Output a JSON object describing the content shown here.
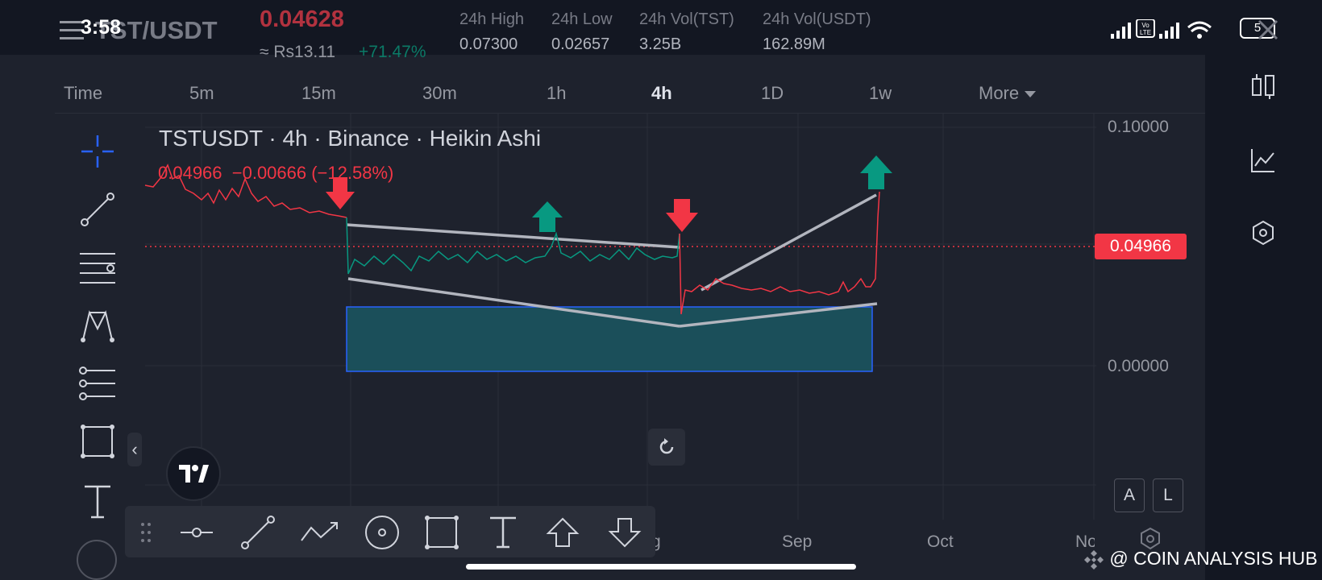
{
  "status_bar": {
    "time": "3:58",
    "battery": "5",
    "lte_label": "Vo LTE"
  },
  "ticker": {
    "symbol": "TST/USDT",
    "price": "0.04628",
    "fiat_price": "≈ Rs13.11",
    "change_pct": "+71.47%",
    "stats": [
      {
        "label": "24h High",
        "value": "0.07300"
      },
      {
        "label": "24h Low",
        "value": "0.02657"
      },
      {
        "label": "24h Vol(TST)",
        "value": "3.25B"
      },
      {
        "label": "24h Vol(USDT)",
        "value": "162.89M"
      }
    ]
  },
  "timeframes": [
    "Time",
    "5m",
    "15m",
    "30m",
    "1h",
    "4h",
    "1D",
    "1w"
  ],
  "active_timeframe": "4h",
  "more_label": "More",
  "chart": {
    "legend_title": "TSTUSDT · 4h · Binance · Heikin Ashi",
    "legend_values": "0.04966  −0.00666 (−12.58%)",
    "current_price_badge": "0.04966",
    "y_ticks": [
      "0.10000",
      "0.00000"
    ],
    "x_ticks": [
      "Aug",
      "Sep",
      "Oct",
      "Nov"
    ],
    "scale_buttons": [
      "A",
      "L"
    ],
    "colors": {
      "up": "#089981",
      "down": "#f23645",
      "zone": "#1b4f5a",
      "zone_border": "#2962ff",
      "trendline": "#b2b5be"
    }
  },
  "left_tools": [
    "crosshair-icon",
    "trendline-icon",
    "fib-icon",
    "pattern-icon",
    "forecast-icon",
    "rectangle-icon",
    "text-icon"
  ],
  "bottom_tools": [
    "horizontal-ray-icon",
    "trendline-icon",
    "path-icon",
    "circle-icon",
    "rectangle-icon",
    "text-icon",
    "arrow-up-icon",
    "arrow-down-icon"
  ],
  "right_tools": [
    "compare-icon",
    "indicators-icon",
    "settings-icon",
    "close-icon"
  ],
  "watermark": "@ COIN ANALYSIS HUB",
  "collapse_label": "‹"
}
